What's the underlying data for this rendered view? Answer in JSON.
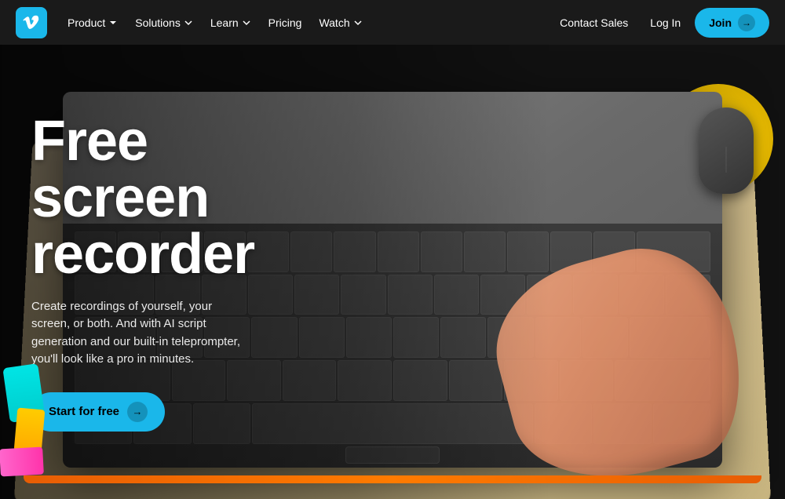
{
  "nav": {
    "logo_alt": "Vimeo",
    "items": [
      {
        "label": "Product",
        "has_dropdown": true
      },
      {
        "label": "Solutions",
        "has_dropdown": true
      },
      {
        "label": "Learn",
        "has_dropdown": true
      },
      {
        "label": "Pricing",
        "has_dropdown": false
      },
      {
        "label": "Watch",
        "has_dropdown": true
      }
    ],
    "contact_sales": "Contact Sales",
    "log_in": "Log In",
    "join": "Join",
    "join_arrow": "→"
  },
  "hero": {
    "title": "Free screen recorder",
    "subtitle": "Create recordings of yourself, your screen, or both. And with AI script generation and our built-in teleprompter, you'll look like a pro in minutes.",
    "cta_label": "Start for free",
    "cta_arrow": "→"
  },
  "colors": {
    "accent": "#1ab7ea",
    "nav_bg": "#1a1a1a",
    "hero_dark": "#111"
  }
}
